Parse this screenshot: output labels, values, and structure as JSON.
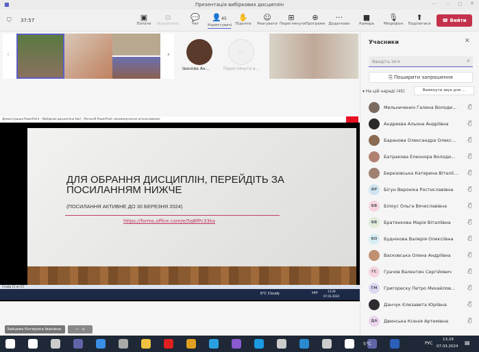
{
  "window": {
    "title": "Презентація вибіркових дисциплін"
  },
  "toolbar": {
    "timer": "37:57",
    "items": [
      {
        "label": "Почати",
        "icon": "screen-record-icon",
        "disabled": false
      },
      {
        "label": "Відкріпити",
        "icon": "unpin-icon",
        "disabled": true
      },
      {
        "label": "Чат",
        "icon": "chat-icon",
        "disabled": false
      },
      {
        "label": "Користувачі",
        "icon": "people-icon",
        "disabled": false,
        "badge": "45",
        "active": true
      },
      {
        "label": "Підняти",
        "icon": "raise-hand-icon",
        "disabled": false
      },
      {
        "label": "Реагувати",
        "icon": "smile-icon",
        "disabled": false
      },
      {
        "label": "Переглянути",
        "icon": "view-grid-icon",
        "disabled": false
      },
      {
        "label": "Програми",
        "icon": "add-app-icon",
        "disabled": false
      },
      {
        "label": "Додатково",
        "icon": "more-icon",
        "disabled": false
      },
      {
        "label": "Камера",
        "icon": "camera-icon",
        "disabled": false
      },
      {
        "label": "Мікрофон",
        "icon": "mic-off-icon",
        "disabled": false
      },
      {
        "label": "Поділитися",
        "icon": "share-icon",
        "disabled": false
      }
    ],
    "leave_label": "Вийти",
    "leave_color": "#c4314b"
  },
  "strip": {
    "participant_name": "Іванова Ан...",
    "view_more": "Переглянути в..."
  },
  "share": {
    "ppt_title": "Демонстрация PowerPoint - [Вибіркові дисципліни бак] - Microsoft PowerPoint некоммерческое использование",
    "slide_title": "ДЛЯ ОБРАННЯ ДИСЦИПЛІН, ПЕРЕЙДІТЬ ЗА ПОСИЛАННЯМ НИЖЧЕ",
    "slide_subtitle": "(ПОСИЛАННЯ АКТИВНЕ ДО 30 БЕРЕЗНЯ 2024)",
    "slide_link": "https://forms.office.com/e/5qBfPc33ka",
    "status": "Слайд 12 из 53",
    "weather": "6°C Cloudy",
    "lang": "УКР",
    "time": "13:29",
    "date": "07.03.2024"
  },
  "presenter_label": "Зайцева Катерина Іванівна",
  "panel": {
    "title": "Учасники",
    "search_placeholder": "Введіть ім'я",
    "invite_label": "Поширити запрошення",
    "section": "На цій нараді (45)",
    "mute_all": "Вимкнути звук для ...",
    "participants": [
      {
        "name": "Мельниченко Галина Володи...",
        "initials": "",
        "color": "#7a6a60"
      },
      {
        "name": "Андреєва Альона Андріївна",
        "initials": "",
        "color": "#2a2a2a"
      },
      {
        "name": "Баранова Олександра Олекс...",
        "initials": "",
        "color": "#8a6a50"
      },
      {
        "name": "Батракова Елеонора Володи...",
        "initials": "",
        "color": "#b08070"
      },
      {
        "name": "Березовська Катерина Віталії...",
        "initials": "",
        "color": "#a08070"
      },
      {
        "name": "Бігун Вероніка Ростиславівна",
        "initials": "БР",
        "color": "#cfe4ee"
      },
      {
        "name": "Білоус Ольга Вячеславівна",
        "initials": "БВ",
        "color": "#f6d5de"
      },
      {
        "name": "Братенкова Марія Віталіївна",
        "initials": "БВ",
        "color": "#e0ecd8"
      },
      {
        "name": "Буднікова Валерія Олексіївна",
        "initials": "БО",
        "color": "#d5eef3"
      },
      {
        "name": "Васковська Олена Андріївна",
        "initials": "",
        "color": "#c09070"
      },
      {
        "name": "Грачов Валентин Сергійович",
        "initials": "ГС",
        "color": "#f6d5de"
      },
      {
        "name": "Григореску Петро Михайлов...",
        "initials": "ГМ",
        "color": "#ddd8f0"
      },
      {
        "name": "Данчук Єлизавета Юріївна",
        "initials": "",
        "color": "#2e2a30"
      },
      {
        "name": "Двинська Ксенія Артемівна",
        "initials": "ДА",
        "color": "#ecd6ec"
      }
    ]
  },
  "taskbar": {
    "weather": "5°C",
    "lang": "РУС",
    "time": "13:29",
    "date": "07.03.2024",
    "notifications": "2"
  }
}
